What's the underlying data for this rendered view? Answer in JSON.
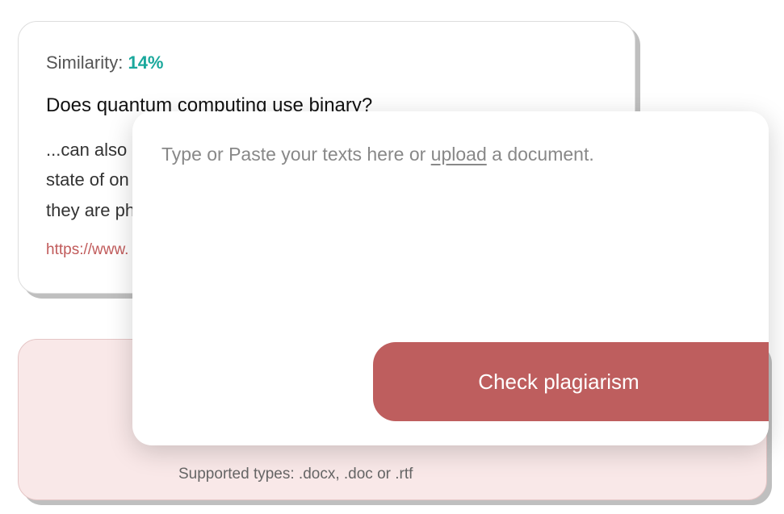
{
  "result": {
    "similarity_label": "Similarity: ",
    "similarity_value": "14%",
    "title": "Does quantum computing use binary?",
    "snippet_line1": "...can also",
    "snippet_line2": "state of on",
    "snippet_line3": "they are ph",
    "url": "https://www."
  },
  "input": {
    "placeholder_before": "Type or Paste your texts here or ",
    "upload_text": "upload",
    "placeholder_after": " a document."
  },
  "button": {
    "check_label": "Check plagiarism"
  },
  "footer": {
    "supported_types": "Supported types: .docx, .doc or .rtf"
  }
}
